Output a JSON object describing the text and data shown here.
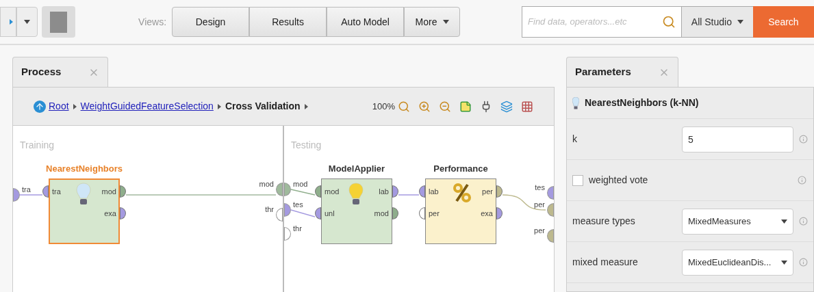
{
  "toolbar": {
    "views_label": "Views:",
    "views": [
      {
        "label": "Design",
        "selected": false
      },
      {
        "label": "Results",
        "selected": false
      },
      {
        "label": "Auto Model",
        "selected": false
      },
      {
        "label": "More",
        "selected": false,
        "kind": "menu"
      }
    ],
    "search": {
      "placeholder": "Find data, operators...etc"
    },
    "scope": "All Studio",
    "search_button": "Search"
  },
  "process_panel": {
    "tab": {
      "label": "Process",
      "selected": true
    },
    "breadcrumb": [
      {
        "label": "Root",
        "kind": "link"
      },
      {
        "label": "WeightGuidedFeatureSelection",
        "kind": "link"
      },
      {
        "label": "Cross Validation",
        "kind": "current"
      }
    ],
    "zoom": "100%",
    "subprocesses": [
      {
        "title": "Training",
        "inputs": [
          {
            "label": "tra",
            "color": "#a49ae0"
          }
        ],
        "outputs": [
          {
            "label": "mod",
            "color": "#9fba9c"
          },
          {
            "label": "thr",
            "color": "#ffffff"
          }
        ],
        "operators": [
          {
            "name": "NearestNeighbors",
            "selected": true,
            "color": "#d6e7cf",
            "inputs": [
              {
                "label": "tra",
                "color": "#a49ae0"
              }
            ],
            "outputs": [
              {
                "label": "mod",
                "color": "#8fae8c"
              },
              {
                "label": "exa",
                "color": "#a49ae0"
              }
            ]
          }
        ]
      },
      {
        "title": "Testing",
        "inputs": [
          {
            "label": "mod",
            "color": "#9fba9c"
          },
          {
            "label": "tes",
            "color": "#a49ae0"
          },
          {
            "label": "thr",
            "color": "#ffffff"
          }
        ],
        "outputs": [
          {
            "label": "tes",
            "color": "#a49ae0"
          },
          {
            "label": "per",
            "color": "#bdb98e"
          },
          {
            "label": "per",
            "color": "#bdb98e"
          }
        ],
        "operators": [
          {
            "name": "ModelApplier",
            "selected": false,
            "color": "#d6e7cf",
            "inputs": [
              {
                "label": "mod",
                "color": "#8fae8c"
              },
              {
                "label": "unl",
                "color": "#a49ae0"
              }
            ],
            "outputs": [
              {
                "label": "lab",
                "color": "#a49ae0"
              },
              {
                "label": "mod",
                "color": "#8fae8c"
              }
            ]
          },
          {
            "name": "Performance",
            "selected": false,
            "color": "#fbf1cc",
            "inputs": [
              {
                "label": "lab",
                "color": "#a49ae0"
              },
              {
                "label": "per",
                "color": "#ffffff"
              }
            ],
            "outputs": [
              {
                "label": "per",
                "color": "#bdb98e"
              },
              {
                "label": "exa",
                "color": "#a49ae0"
              }
            ]
          }
        ]
      }
    ]
  },
  "parameters_panel": {
    "tab": {
      "label": "Parameters",
      "selected": true
    },
    "operator": "NearestNeighbors (k-NN)",
    "rows": [
      {
        "kind": "text",
        "label": "k",
        "value": "5"
      },
      {
        "kind": "checkbox",
        "label": "weighted vote",
        "checked": false
      },
      {
        "kind": "select",
        "label": "measure types",
        "value": "MixedMeasures"
      },
      {
        "kind": "select",
        "label": "mixed measure",
        "value": "MixedEuclideanDis..."
      }
    ]
  }
}
